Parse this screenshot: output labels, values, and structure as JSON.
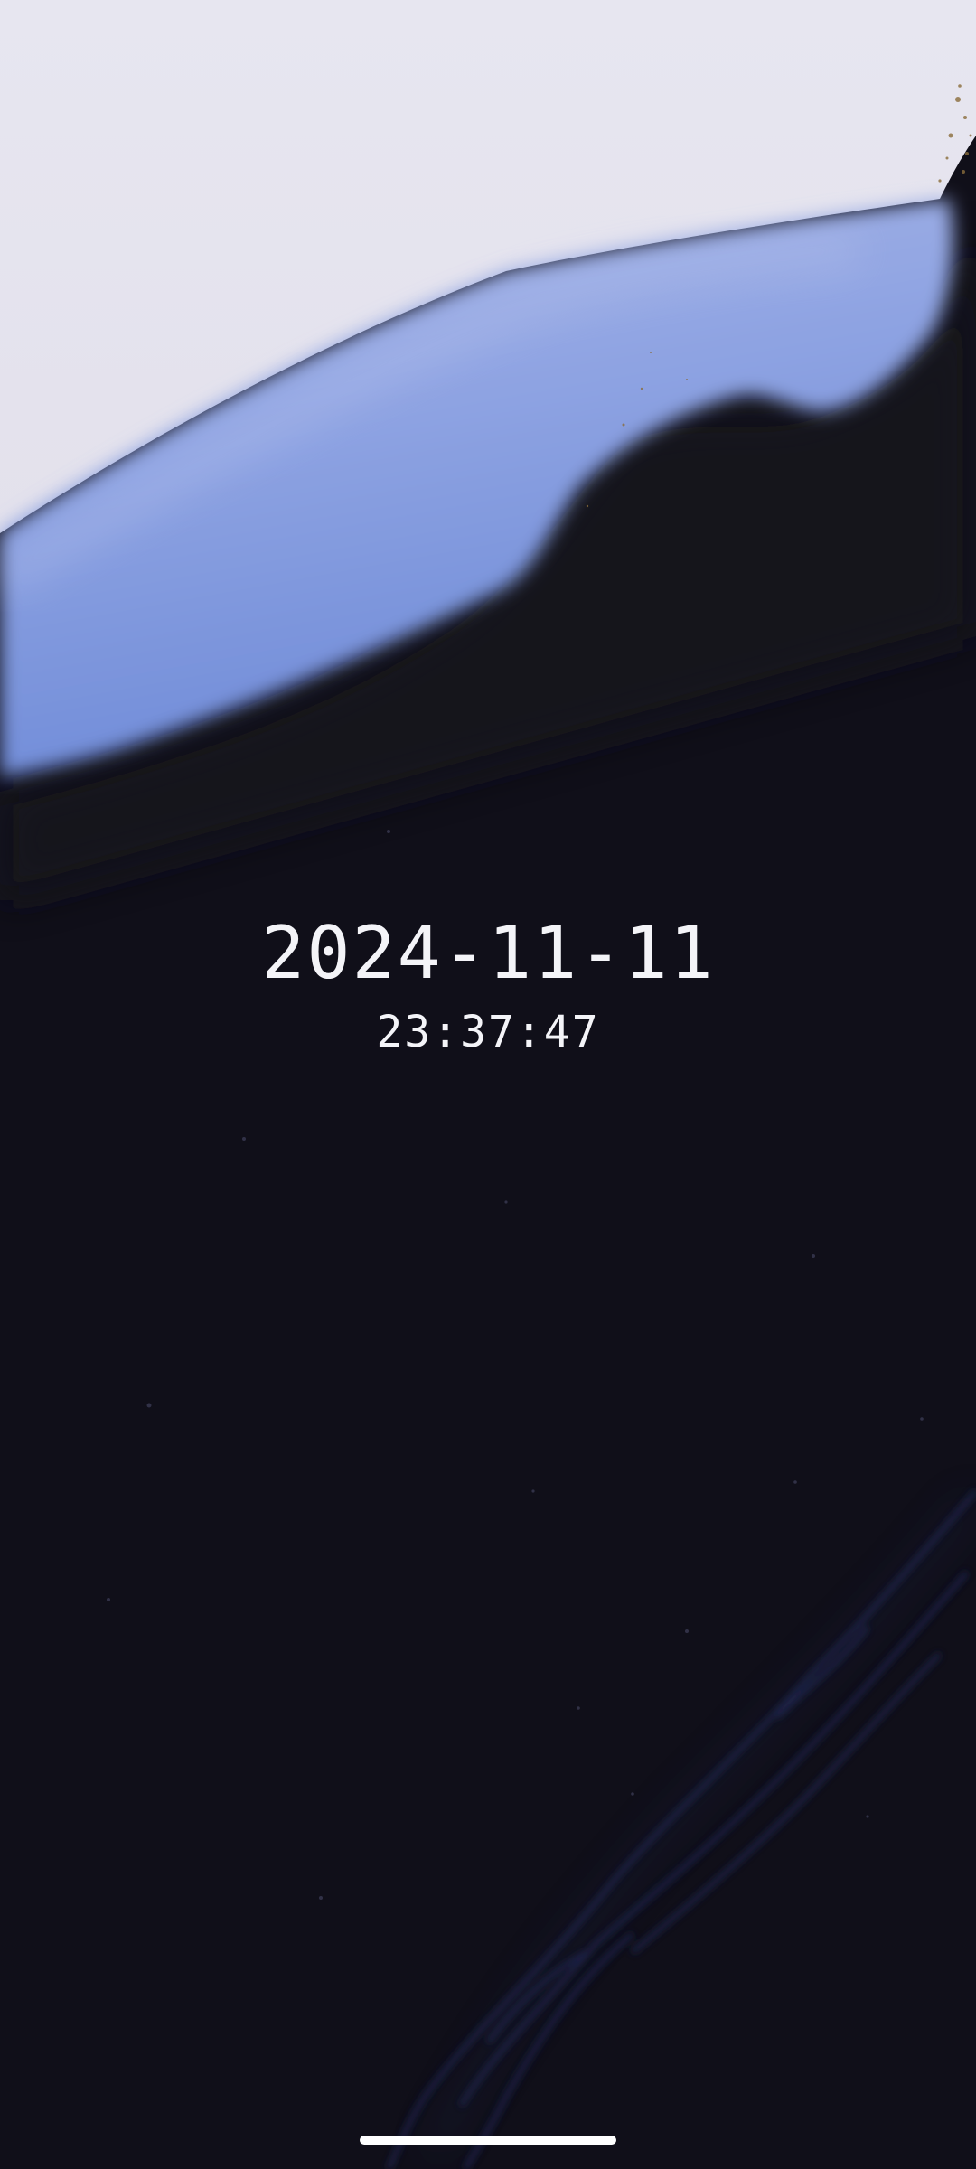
{
  "wallpaper": {
    "name": "abstract-ink-wallpaper",
    "colors": {
      "sky": "#e6e4ef",
      "blue_wave": "#7d97db",
      "dark_base": "#100f19",
      "streak": "#1e2446",
      "gold_speck": "#8a6d3b"
    }
  },
  "clock": {
    "date": "2024-11-11",
    "time": "23:37:47",
    "text_color": "#f4f4f8"
  },
  "system": {
    "home_indicator_color": "#ffffff"
  }
}
